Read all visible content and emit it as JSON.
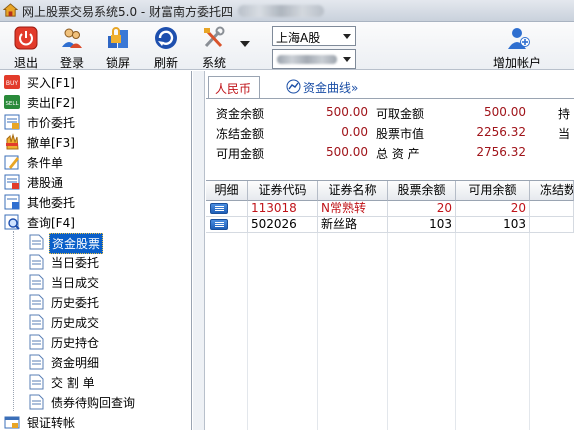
{
  "window": {
    "title": "网上股票交易系统5.0 - 财富南方委托四"
  },
  "toolbar": {
    "buttons": [
      {
        "label": "退出",
        "icon": "power-icon"
      },
      {
        "label": "登录",
        "icon": "users-icon"
      },
      {
        "label": "锁屏",
        "icon": "lock-screen-icon"
      },
      {
        "label": "刷新",
        "icon": "refresh-icon"
      },
      {
        "label": "系统",
        "icon": "tools-icon"
      }
    ],
    "market_select": {
      "value": "上海A股"
    },
    "add_account_label": "增加帐户"
  },
  "sidebar": {
    "items": [
      {
        "label": "买入[F1]",
        "icon": "buy-icon"
      },
      {
        "label": "卖出[F2]",
        "icon": "sell-icon"
      },
      {
        "label": "市价委托",
        "icon": "market-order-icon"
      },
      {
        "label": "撤单[F3]",
        "icon": "cancel-order-icon"
      },
      {
        "label": "条件单",
        "icon": "conditional-order-icon"
      },
      {
        "label": "港股通",
        "icon": "hk-connect-icon"
      },
      {
        "label": "其他委托",
        "icon": "other-order-icon"
      },
      {
        "label": "查询[F4]",
        "icon": "query-icon"
      }
    ],
    "query_children": [
      {
        "label": "资金股票",
        "selected": true
      },
      {
        "label": "当日委托"
      },
      {
        "label": "当日成交"
      },
      {
        "label": "历史委托"
      },
      {
        "label": "历史成交"
      },
      {
        "label": "历史持仓"
      },
      {
        "label": "资金明细"
      },
      {
        "label": "交 割 单"
      },
      {
        "label": "债券待购回查询"
      }
    ],
    "last_item": {
      "label": "银证转帐",
      "icon": "bank-transfer-icon"
    }
  },
  "main": {
    "tabs": {
      "rmb": "人民币",
      "fund_curve": "资金曲线»"
    },
    "summary": {
      "col1": [
        {
          "label": "资金余额",
          "value": "500.00"
        },
        {
          "label": "冻结金额",
          "value": "0.00"
        },
        {
          "label": "可用金额",
          "value": "500.00"
        }
      ],
      "col2": [
        {
          "label": "可取金额",
          "value": "500.00"
        },
        {
          "label": "股票市值",
          "value": "2256.32"
        },
        {
          "label": "总 资 产",
          "value": "2756.32"
        }
      ],
      "col3": [
        {
          "label": "持"
        },
        {
          "label": "当"
        }
      ]
    },
    "table": {
      "columns": [
        "明细",
        "证券代码",
        "证券名称",
        "股票余额",
        "可用余额",
        "冻结数"
      ],
      "rows": [
        {
          "code": "113018",
          "name": "N常熟转",
          "balance": "20",
          "available": "20",
          "highlight": true
        },
        {
          "code": "502026",
          "name": "新丝路",
          "balance": "103",
          "available": "103",
          "highlight": false
        }
      ]
    }
  },
  "colors": {
    "accent_red": "#c0141a",
    "value_red": "#a0141a",
    "selection_blue": "#0a5fc9",
    "link_blue": "#1a4ea6"
  }
}
